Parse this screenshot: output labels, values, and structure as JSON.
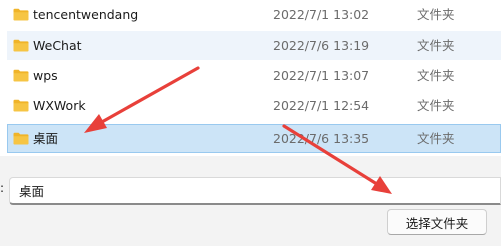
{
  "file_list": {
    "rows": [
      {
        "name": "tencentwendang",
        "date": "2022/7/1 13:02",
        "type": "文件夹",
        "state": "normal"
      },
      {
        "name": "WeChat",
        "date": "2022/7/6 13:19",
        "type": "文件夹",
        "state": "hover"
      },
      {
        "name": "wps",
        "date": "2022/7/1 13:07",
        "type": "文件夹",
        "state": "normal"
      },
      {
        "name": "WXWork",
        "date": "2022/7/1 12:54",
        "type": "文件夹",
        "state": "normal"
      },
      {
        "name": "桌面",
        "date": "2022/7/6 13:35",
        "type": "文件夹",
        "state": "selected"
      }
    ]
  },
  "folder_field": {
    "label": ":",
    "value": "桌面"
  },
  "buttons": {
    "select_folder": "选择文件夹"
  },
  "icons": {
    "folder": "folder-icon"
  },
  "colors": {
    "selected_background": "#cce4f7",
    "selected_border": "#99c9ef",
    "hover_background": "#eef4fb",
    "annotation_arrow": "#e8403a",
    "folder_yellow": "#f6c544"
  }
}
